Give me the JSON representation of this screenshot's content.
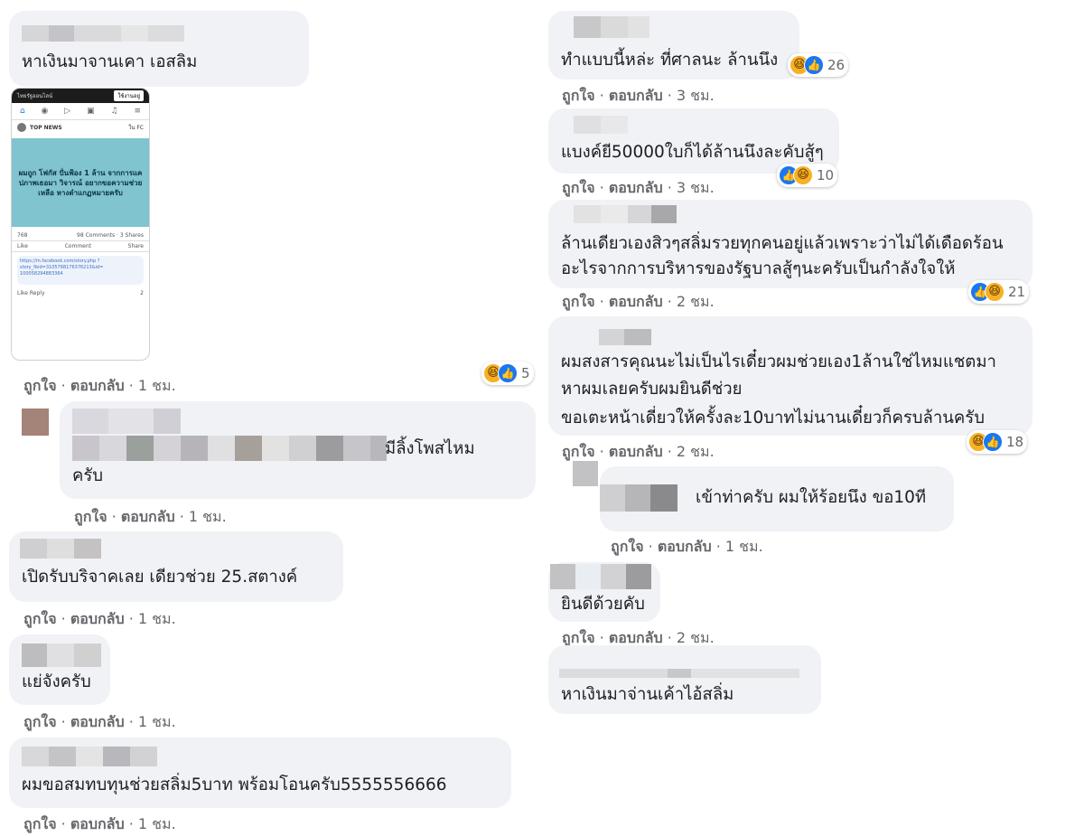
{
  "meta_label": {
    "like": "ถูกใจ",
    "sep": " · ",
    "reply": "ตอบกลับ"
  },
  "left": [
    {
      "text": "หาเงินมาจานเคา เอสลิม",
      "time": "1 ชม.",
      "reaction": {
        "icons": [
          "haha",
          "like"
        ],
        "count": "5"
      }
    },
    {
      "text_line1": "มีลิ้งโพสไหม",
      "text_line2": "ครับ",
      "time": "1 ชม."
    },
    {
      "text": "เปิดรับบริจาคเลย เดียวช่วย 25.สตางค์",
      "time": "1 ชม."
    },
    {
      "text": "แย่จังครับ",
      "time": "1 ชม."
    },
    {
      "text": "ผมขอสมทบทุนช่วยสลิ่ม5บาท พร้อมโอนครับ5555556666",
      "time": "1 ชม."
    }
  ],
  "phone": {
    "top_left": "ไทยรัฐออนไลน์",
    "top_button": "ใช้งานอยู่",
    "page_name": "TOP NEWS",
    "group": "ใน FC",
    "poster_text": "ผมถูก โฟกัส ปั่นฟ้อง 1 ล้าน จากการแคปภาพเธอมา วิจารณ์ อยากขอความช่วยเหลือ หางตำแกฏหมายครับ",
    "reaction_count": "768",
    "comments_shares": "98 Comments · 3 Shares",
    "like": "Like",
    "comment": "Comment",
    "share": "Share",
    "link_text": "https://m.facebook.com/story.php ?story_fbid=3105768176376213&id= 100058294883364",
    "reply_like": "Like",
    "reply_reply": "Reply",
    "reply_count": "2"
  },
  "right": [
    {
      "text": "ทำแบบนี้หล่ะ ที่ศาลนะ ล้านนึง",
      "time": "3 ชม.",
      "reaction": {
        "icons": [
          "haha",
          "like"
        ],
        "count": "26"
      }
    },
    {
      "text": "แบงค์ยี50000ใบก็ได้ล้านนึงละคับสู้ๆ",
      "time": "3 ชม.",
      "reaction": {
        "icons": [
          "like",
          "haha"
        ],
        "count": "10"
      }
    },
    {
      "text_line1": "ล้านเดียวเองสิวๆสลิ่มรวยทุกคนอยู่แล้วเพราะว่าไม่ได้เดือดร้อน",
      "text_line2": "อะไรจากการบริหารของรัฐบาลสู้ๆนะครับเป็นกำลังใจให้",
      "time": "2 ชม.",
      "reaction": {
        "icons": [
          "like",
          "haha"
        ],
        "count": "21"
      }
    },
    {
      "text_line1": "ผมสงสารคุณนะไม่เป็นไรเดี๋ยวผมช่วยเอง1ล้านใช่ไหมแชตมา",
      "text_line2": "หาผมเลยครับผมยินดีช่วย",
      "text_line3": "ขอเตะหน้าเดี่ยวให้ครั้งละ10บาทไม่นานเดี๋ยวก็ครบล้านครับ",
      "time": "2 ชม.",
      "reaction": {
        "icons": [
          "haha",
          "like"
        ],
        "count": "18"
      }
    },
    {
      "text": "เข้าท่าครับ ผมให้ร้อยนึง ขอ10ที",
      "time": "1 ชม."
    },
    {
      "text": "ยินดีด้วยคับ",
      "time": "2 ชม."
    },
    {
      "text": "หาเงินมาจ่านเค้าไอ้สลิ่ม"
    }
  ],
  "colors": {
    "bubble": "#f0f2f5",
    "meta": "#65676b",
    "like_blue": "#1877f2",
    "haha_yellow": "#f7b125"
  }
}
